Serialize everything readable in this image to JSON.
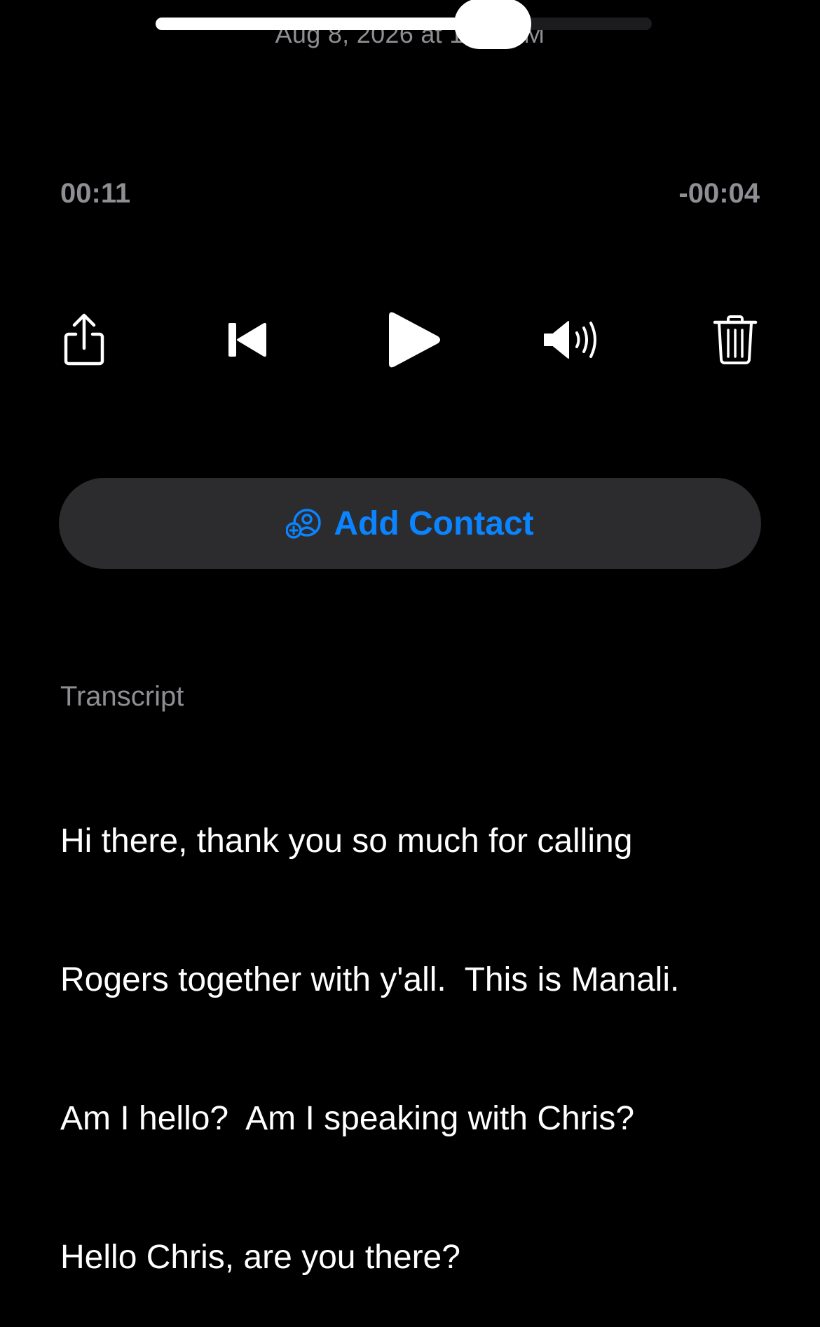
{
  "header": {
    "timestamp": "Aug 8, 2026 at 1:01 PM"
  },
  "player": {
    "elapsed": "00:11",
    "remaining": "-00:04",
    "progress": 0.68,
    "controls": {
      "share_icon": "share-icon",
      "skip_back_icon": "skip-back-icon",
      "play_icon": "play-icon",
      "speaker_icon": "speaker-icon",
      "trash_icon": "trash-icon"
    }
  },
  "actions": {
    "add_contact_label": "Add Contact",
    "add_contact_icon": "person-add-icon"
  },
  "transcript": {
    "heading": "Transcript",
    "lines": [
      "Hi there, thank you so much for calling",
      "Rogers together with y'all.  This is Manali.",
      "Am I hello?  Am I speaking with Chris?",
      "Hello Chris, are you there?"
    ]
  },
  "colors": {
    "background": "#000000",
    "accent": "#0a84ff",
    "secondary_text": "#8e8e93",
    "button_bg": "#2c2c2e"
  }
}
